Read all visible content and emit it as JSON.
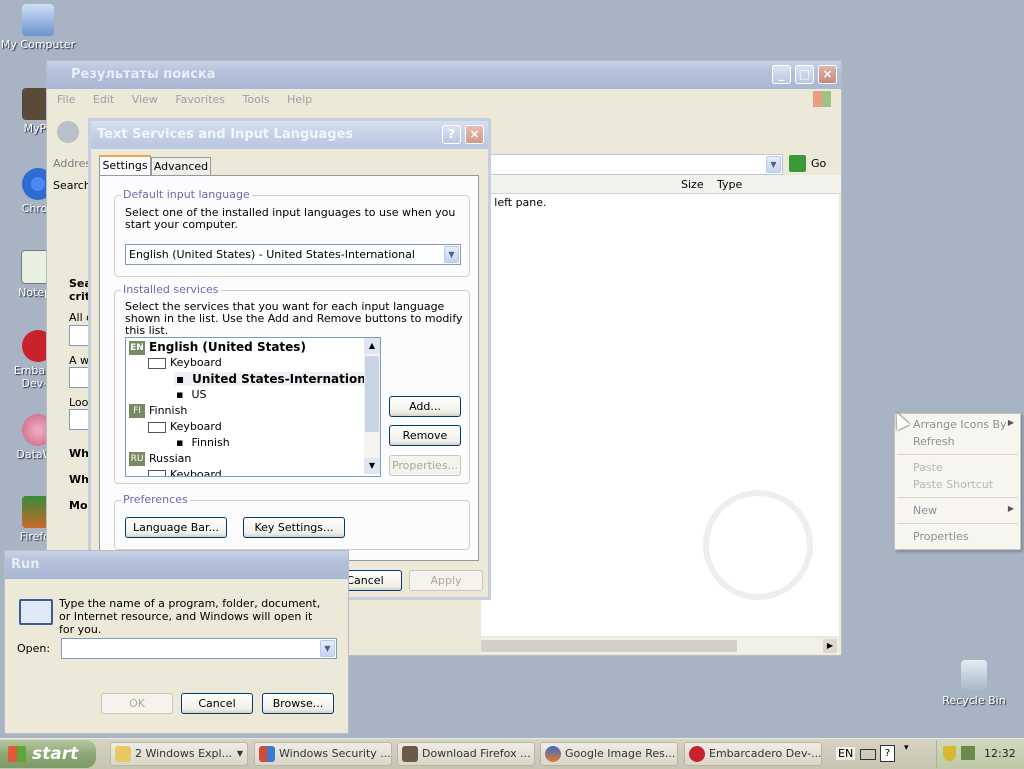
{
  "desktop": {
    "icons": [
      {
        "label": "My Computer"
      },
      {
        "label": "MyPa"
      },
      {
        "label": "Chron"
      },
      {
        "label": "Notepa"
      },
      {
        "label": "Embarca Dev-C"
      },
      {
        "label": "DataWa"
      },
      {
        "label": "Firefox"
      },
      {
        "label": "Recycle Bin"
      }
    ]
  },
  "search_window": {
    "title": "Результаты поиска",
    "menu": [
      "File",
      "Edit",
      "View",
      "Favorites",
      "Tools",
      "Help"
    ],
    "address_label": "Addres",
    "search_label": "Search",
    "go_label": "Go",
    "columns": [
      "Size",
      "Type"
    ],
    "pane_text": "e left pane.",
    "left_pane": [
      "Sea",
      "crit",
      "All o",
      "A wo",
      "Look",
      "Wh",
      "Wh",
      "Mo"
    ]
  },
  "text_services_dialog": {
    "title": "Text Services and Input Languages",
    "tabs": [
      "Settings",
      "Advanced"
    ],
    "default_input": {
      "group_label": "Default input language",
      "description": "Select one of the installed input languages to use when you start your computer.",
      "selected": "English (United States) - United States-International"
    },
    "installed_services": {
      "group_label": "Installed services",
      "description": "Select the services that you want for each input language shown in the list. Use the Add and Remove buttons to modify this list.",
      "tree": [
        {
          "badge": "EN",
          "label": "English (United States)"
        },
        {
          "label": "Keyboard"
        },
        {
          "label": "United States-International"
        },
        {
          "label": "US"
        },
        {
          "badge": "FI",
          "label": "Finnish"
        },
        {
          "label": "Keyboard"
        },
        {
          "label": "Finnish"
        },
        {
          "badge": "RU",
          "label": "Russian"
        },
        {
          "label": "Keyboard"
        }
      ],
      "add_label": "Add...",
      "remove_label": "Remove",
      "properties_label": "Properties..."
    },
    "preferences": {
      "group_label": "Preferences",
      "language_bar_label": "Language Bar...",
      "key_settings_label": "Key Settings..."
    },
    "ok_label": "OK",
    "cancel_label": "Cancel",
    "apply_label": "Apply"
  },
  "run_dialog": {
    "title": "Run",
    "description": "Type the name of a program, folder, document, or Internet resource, and Windows will open it for you.",
    "open_label": "Open:",
    "open_value": "",
    "ok_label": "OK",
    "cancel_label": "Cancel",
    "browse_label": "Browse..."
  },
  "context_menu": {
    "items": [
      "Arrange Icons By",
      "Refresh",
      "Paste",
      "Paste Shortcut",
      "New",
      "Properties"
    ]
  },
  "taskbar": {
    "start_label": "start",
    "tasks": [
      {
        "label": "2 Windows Expl..."
      },
      {
        "label": "Windows Security ..."
      },
      {
        "label": "Download Firefox ..."
      },
      {
        "label": "Google Image Res..."
      },
      {
        "label": "Embarcadero Dev-..."
      }
    ],
    "lang": "EN",
    "clock": "12:32"
  }
}
